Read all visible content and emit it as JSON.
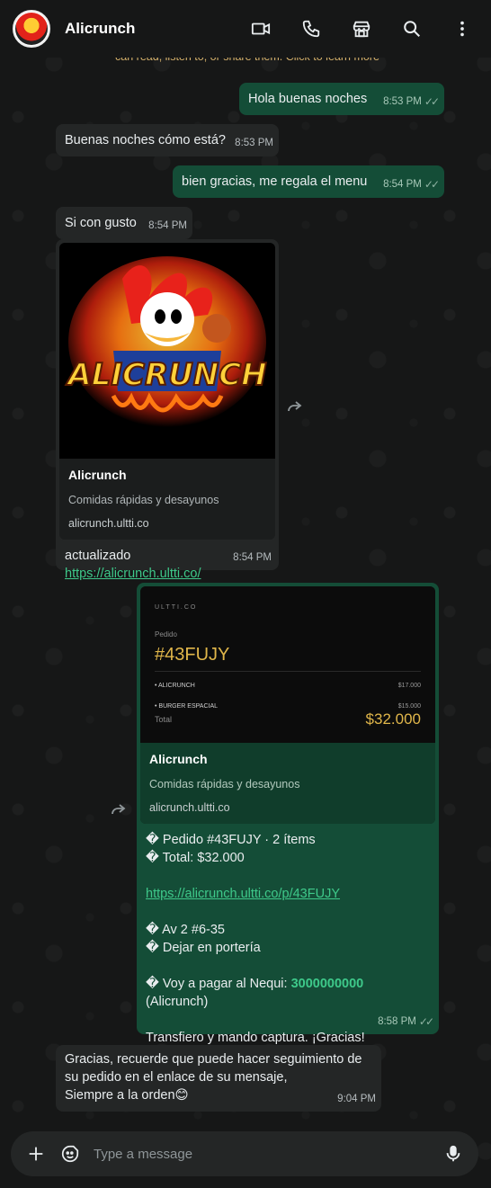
{
  "header": {
    "contact_name": "Alicrunch",
    "avatar_label": "ALICRUNCH",
    "icons": [
      "video-call-icon",
      "voice-call-icon",
      "store-icon",
      "search-icon",
      "more-icon"
    ]
  },
  "banner": {
    "text": "can read, listen to, or share them. Click to learn more"
  },
  "messages": [
    {
      "dir": "out",
      "text": "Hola buenas noches",
      "time": "8:53 PM"
    },
    {
      "dir": "in",
      "text": "Buenas noches cómo está?",
      "time": "8:53 PM"
    },
    {
      "dir": "out",
      "text": "bien gracias, me regala el menu",
      "time": "8:54 PM"
    },
    {
      "dir": "in",
      "text": "Si con gusto",
      "time": "8:54 PM"
    },
    {
      "dir": "in",
      "card": {
        "title": "Alicrunch",
        "desc": "Comidas rápidas y desayunos",
        "domain": "alicrunch.ultti.co",
        "image_text": "ALICRUNCH"
      },
      "text": "actualizado",
      "link": "https://alicrunch.ultti.co/",
      "time": "8:54 PM"
    },
    {
      "dir": "out",
      "receipt": {
        "brand": "ULTTI.CO",
        "label": "Pedido",
        "code": "#43FUJY",
        "items": [
          {
            "name": "• ALICRUNCH",
            "price": "$17.000"
          },
          {
            "name": "• BURGER ESPACIAL",
            "price": "$15.000"
          }
        ],
        "total_label": "Total",
        "total": "$32.000"
      },
      "card": {
        "title": "Alicrunch",
        "desc": "Comidas rápidas y desayunos",
        "domain": "alicrunch.ultti.co"
      },
      "lines": {
        "l1": "� Pedido #43FUJY · 2 ítems",
        "l2": "� Total: $32.000",
        "link": "https://alicrunch.ultti.co/p/43FUJY",
        "l3": "� Av 2 #6-35",
        "l4": "� Dejar en portería",
        "l5_prefix": "� Voy a pagar al Nequi: ",
        "l5_number": "3000000000",
        "l6": "(Alicrunch)",
        "l7": "Transfiero y mando captura. ¡Gracias!"
      },
      "time": "8:58 PM"
    },
    {
      "dir": "in",
      "text_lines": [
        "Gracias, recuerde que puede hacer seguimiento de",
        "su pedido en el enlace de su mensaje,",
        "Siempre a la orden😊"
      ],
      "time": "9:04 PM"
    }
  ],
  "composer": {
    "placeholder": "Type a message"
  },
  "colors": {
    "incoming": "#242626",
    "outgoing": "#144d37",
    "accent_green": "#3ec98a",
    "receipt_gold": "#e0b64a"
  }
}
